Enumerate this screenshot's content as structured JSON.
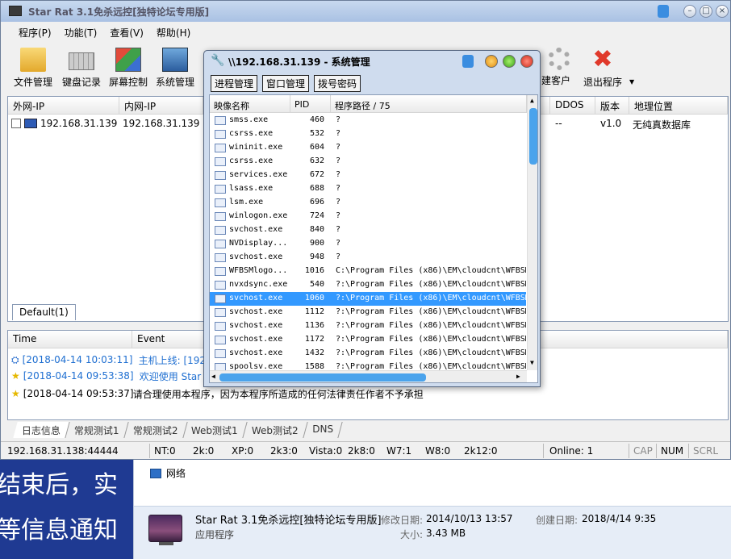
{
  "window": {
    "title": "Star Rat 3.1免杀远控[独特论坛专用版]"
  },
  "menu": [
    "程序(P)",
    "功能(T)",
    "查看(V)",
    "帮助(H)"
  ],
  "toolbar": {
    "file_manager": "文件管理",
    "keylogger": "键盘记录",
    "screen_control": "屏幕控制",
    "system_manager": "系统管理",
    "build_client": "建客户",
    "exit": "退出程序"
  },
  "hosts": {
    "columns": [
      "外网-IP",
      "内网-IP",
      "DDOS",
      "版本",
      "地理位置"
    ],
    "rows": [
      {
        "wan_ip": "192.168.31.139",
        "lan_ip": "192.168.31.139",
        "ddos": "--",
        "version": "v1.0",
        "location": "无纯真数据库"
      }
    ],
    "group_tab": "Default(1)"
  },
  "log": {
    "columns": [
      "Time",
      "Event"
    ],
    "rows": [
      {
        "time": "[2018-04-14 10:03:11]",
        "event": "主机上线: [192",
        "icon": "network-icon",
        "color": "#1f6fd1"
      },
      {
        "time": "[2018-04-14 09:53:38]",
        "event": "欢迎使用 Star R",
        "icon": "star-icon",
        "color": "#1f6fd1"
      },
      {
        "time": "[2018-04-14 09:53:37]",
        "event": "请合理使用本程序，因为本程序所造成的任何法律责任作者不予承担",
        "icon": "star-icon",
        "color": "#000000"
      }
    ]
  },
  "bottom_tabs": [
    "日志信息",
    "常规测试1",
    "常规测试2",
    "Web测试1",
    "Web测试2",
    "DNS"
  ],
  "status": {
    "address": "192.168.31.138:44444",
    "nt": "NT:0",
    "k2k": "2k:0",
    "xp": "XP:0",
    "k2k3": "2k3:0",
    "vista": "Vista:0",
    "k2k8": "2k8:0",
    "w7": "W7:1",
    "w8": "W8:0",
    "k2k12": "2k12:0",
    "online": "Online: 1",
    "cap": "CAP",
    "num": "NUM",
    "scrl": "SCRL"
  },
  "dialog": {
    "title": "\\\\192.168.31.139 - 系统管理",
    "tabs": [
      "进程管理",
      "窗口管理",
      "拨号密码"
    ],
    "columns": [
      "映像名称",
      "PID",
      "程序路径 / 75"
    ],
    "processes": [
      {
        "name": "smss.exe",
        "pid": "460",
        "path": "?"
      },
      {
        "name": "csrss.exe",
        "pid": "532",
        "path": "?"
      },
      {
        "name": "wininit.exe",
        "pid": "604",
        "path": "?"
      },
      {
        "name": "csrss.exe",
        "pid": "632",
        "path": "?"
      },
      {
        "name": "services.exe",
        "pid": "672",
        "path": "?"
      },
      {
        "name": "lsass.exe",
        "pid": "688",
        "path": "?"
      },
      {
        "name": "lsm.exe",
        "pid": "696",
        "path": "?"
      },
      {
        "name": "winlogon.exe",
        "pid": "724",
        "path": "?"
      },
      {
        "name": "svchost.exe",
        "pid": "840",
        "path": "?"
      },
      {
        "name": "NVDisplay...",
        "pid": "900",
        "path": "?"
      },
      {
        "name": "svchost.exe",
        "pid": "948",
        "path": "?"
      },
      {
        "name": "WFBSMlogo...",
        "pid": "1016",
        "path": "C:\\Program Files (x86)\\EM\\cloudcnt\\WFBSM"
      },
      {
        "name": "nvxdsync.exe",
        "pid": "540",
        "path": "?:\\Program Files (x86)\\EM\\cloudcnt\\WFBSM"
      },
      {
        "name": "svchost.exe",
        "pid": "1060",
        "path": "?:\\Program Files (x86)\\EM\\cloudcnt\\WFBSM",
        "selected": true
      },
      {
        "name": "svchost.exe",
        "pid": "1112",
        "path": "?:\\Program Files (x86)\\EM\\cloudcnt\\WFBSM"
      },
      {
        "name": "svchost.exe",
        "pid": "1136",
        "path": "?:\\Program Files (x86)\\EM\\cloudcnt\\WFBSM"
      },
      {
        "name": "svchost.exe",
        "pid": "1172",
        "path": "?:\\Program Files (x86)\\EM\\cloudcnt\\WFBSM"
      },
      {
        "name": "svchost.exe",
        "pid": "1432",
        "path": "?:\\Program Files (x86)\\EM\\cloudcnt\\WFBSM"
      },
      {
        "name": "spoolsv.exe",
        "pid": "1588",
        "path": "?:\\Program Files (x86)\\EM\\cloudcnt\\WFBSM"
      }
    ]
  },
  "explorer": {
    "network_label": "网络",
    "file_name": "Star Rat 3.1免杀远控[独特论坛专用版]",
    "file_type": "应用程序",
    "modified_label": "修改日期:",
    "modified_value": "2014/10/13 13:57",
    "created_label": "创建日期:",
    "created_value": "2018/4/14 9:35",
    "size_label": "大小:",
    "size_value": "3.43 MB"
  },
  "desktop_text": [
    "结束后，实",
    "等信息通知"
  ]
}
